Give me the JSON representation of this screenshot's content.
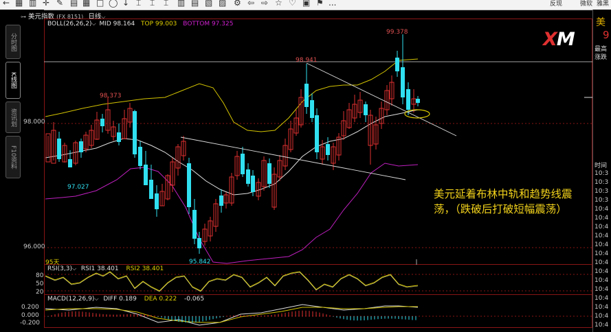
{
  "toolbar": {
    "icons": [
      "back-icon",
      "grid-icon",
      "chart-icon",
      "crosshair-icon",
      "draw-icon",
      "grid2-icon",
      "rect-icon",
      "circle-icon",
      "line-icon",
      "text-icon",
      "text2-icon",
      "text3-icon",
      "channel-icon",
      "fib-icon",
      "cycle-icon",
      "gann-icon",
      "arrow-icon",
      "arrow2-icon",
      "star-icon",
      "heart-icon",
      "mark-icon",
      "more-icon"
    ],
    "more": "...",
    "right_items": [
      "反现",
      "微软",
      "雅黑"
    ]
  },
  "left_tabs": [
    "分时图",
    "K线图",
    "资讯划",
    "F10资料"
  ],
  "title": {
    "symbol_icon": "⊶",
    "name": "美元指数",
    "code": "(FX 8151)",
    "period": "日线"
  },
  "boll": {
    "label": "BOLL(26,26,2)",
    "mid": "MID 98.164",
    "top": "TOP 99.003",
    "bottom": "BOTTOM 97.325",
    "colors": {
      "label": "#e0e0e0",
      "mid": "#e0e0e0",
      "top": "#e0d000",
      "bottom": "#d020d0"
    }
  },
  "price_labels": {
    "high": "99.378",
    "p1": "98.941",
    "p2": "98.373",
    "p3": "97.027",
    "low": "95.842"
  },
  "y_axis": {
    "main": [
      "98.000",
      "96.000"
    ],
    "rsi": [
      "80",
      "50",
      "20"
    ],
    "macd": [
      "0.200",
      "0.000",
      "-0.200"
    ]
  },
  "days_label": "95天",
  "rsi": {
    "label": "RSI(3,3)",
    "rsi1": "RSI1 38.401",
    "rsi2": "RSI2 38.401"
  },
  "macd": {
    "label": "MACD(12,26,9)",
    "diff": "DIFF 0.189",
    "dea": "DEA 0.222",
    "macd_val": "-0.065"
  },
  "annotation": "美元延着布林中轨和趋势线震荡，（跌破后打破短幅震荡）",
  "logo": {
    "prefix": "X",
    "rest": "M"
  },
  "sidebar": {
    "symbol": "美",
    "price": "9",
    "labels": [
      "最高",
      "涨跌"
    ],
    "time_header": "时间",
    "times": [
      "10:3",
      "10:3",
      "10:3",
      "10:3",
      "10:4",
      "10:4",
      "10:4",
      "10:4",
      "10:4",
      "10:4",
      "10:4",
      "10:4",
      "10:4",
      "10:4",
      "10:4",
      "10:4",
      "10:4",
      "10:4"
    ]
  },
  "colors": {
    "up": "#e03030",
    "down": "#30e0f0",
    "mid": "#e0e0e0",
    "top": "#d4c400",
    "bottom": "#c020c0",
    "grid": "#8a1515"
  }
}
